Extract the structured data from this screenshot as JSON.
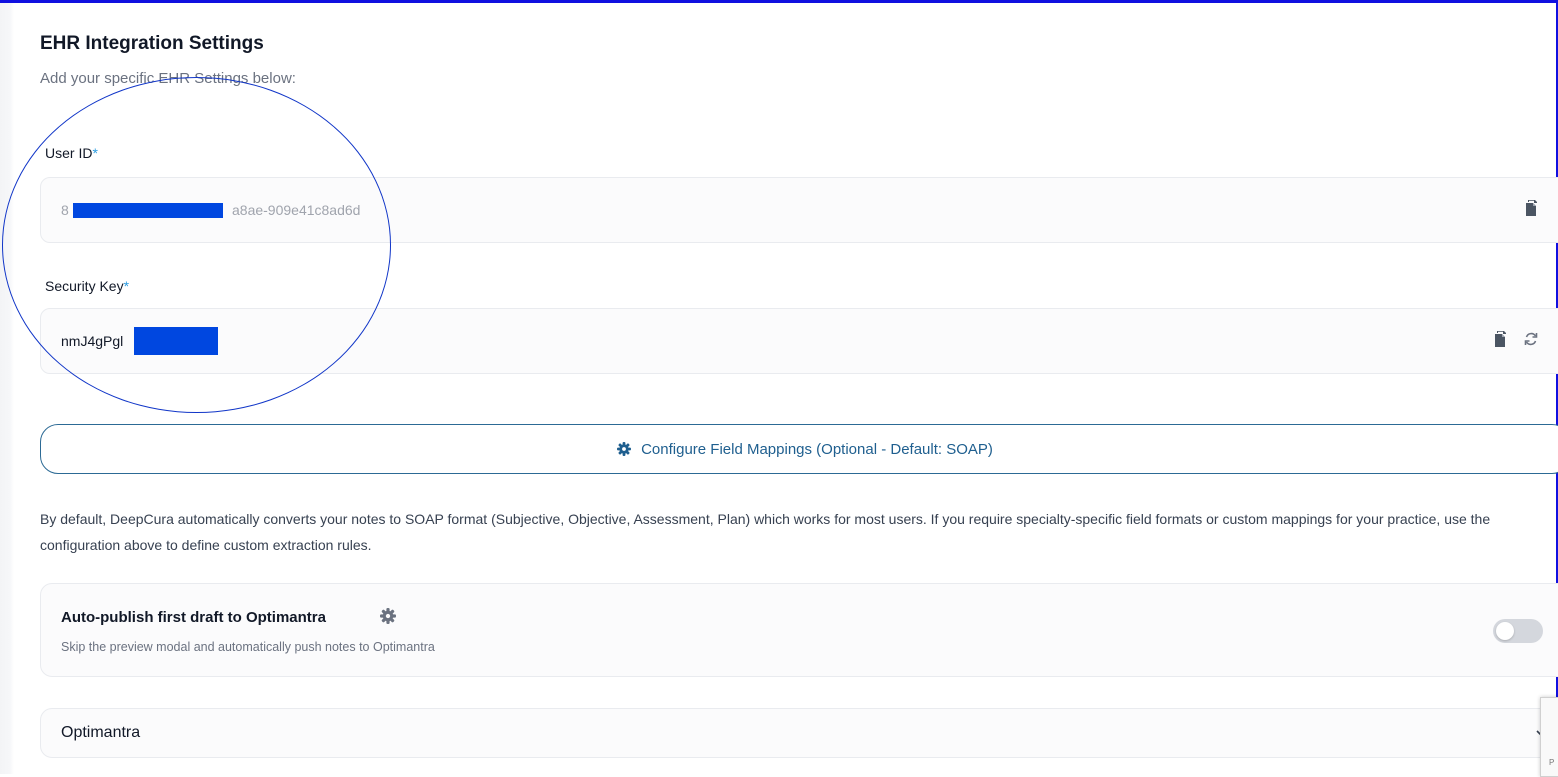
{
  "header": {
    "title": "EHR Integration Settings",
    "subtitle": "Add your specific EHR Settings below:"
  },
  "user_id": {
    "label": "User ID",
    "required_mark": "*",
    "visible_prefix": "8",
    "visible_suffix": "a8ae-909e41c8ad6d",
    "copy_icon": "copy-icon"
  },
  "security_key": {
    "label": "Security Key",
    "required_mark": "*",
    "visible_prefix": "nmJ4gPgl",
    "copy_icon": "copy-icon",
    "regenerate_icon": "refresh-icon"
  },
  "config_button": {
    "icon": "gear-icon",
    "label": "Configure Field Mappings (Optional - Default: SOAP)"
  },
  "description": "By default, DeepCura automatically converts your notes to SOAP format (Subjective, Objective, Assessment, Plan) which works for most users. If you require specialty-specific field formats or custom mappings for your practice, use the configuration above to define custom extraction rules.",
  "auto_publish": {
    "title": "Auto-publish first draft to Optimantra",
    "subtitle": "Skip the preview modal and automatically push notes to Optimantra",
    "enabled": false,
    "settings_icon": "gear-icon"
  },
  "ehr_accordion": {
    "label": "Optimantra",
    "icon": "chevron-down-icon"
  },
  "colors": {
    "accent": "#1f5f8f",
    "required": "#2a9be0",
    "redaction": "#0047e0",
    "annotation_circle": "#1136c8"
  }
}
